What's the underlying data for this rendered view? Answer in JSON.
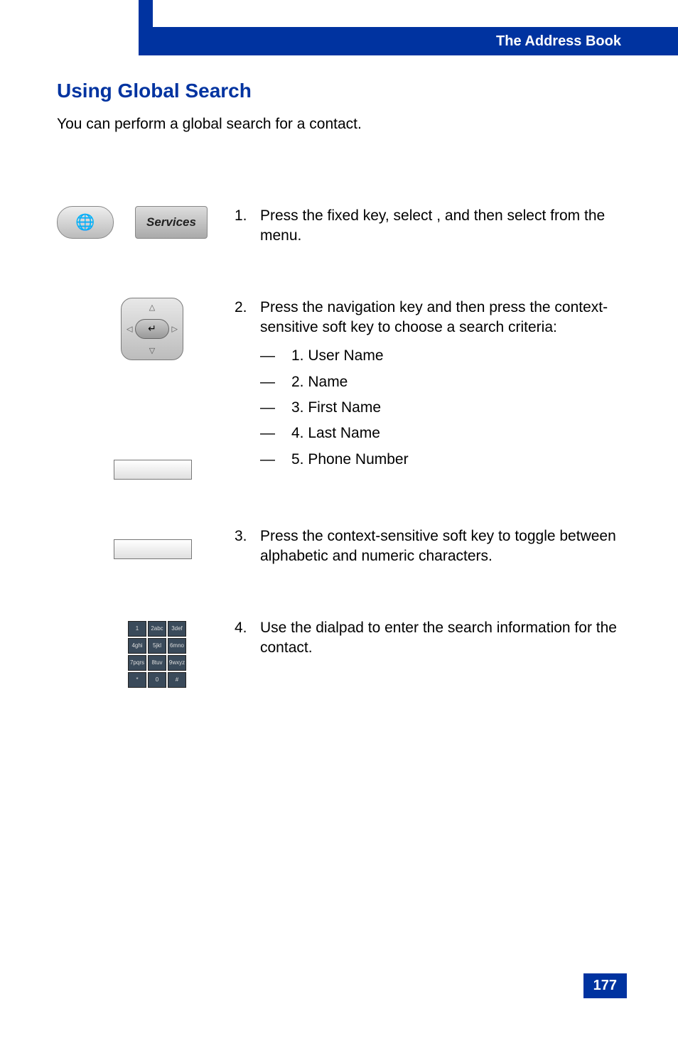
{
  "header": {
    "chapter_title": "The Address Book"
  },
  "section": {
    "title": "Using Global Search",
    "intro": "You can perform a global search for a contact."
  },
  "icons": {
    "services_label": "Services"
  },
  "steps": [
    {
      "num": "1.",
      "body": "Press the              fixed key, select            , and then select            from the menu."
    },
    {
      "num": "2.",
      "body": "Press the              navigation key and then press the            context-sensitive soft key to choose a search criteria:",
      "sub": [
        "1. User Name",
        "2. Name",
        "3. First Name",
        "4. Last Name",
        "5. Phone Number"
      ]
    },
    {
      "num": "3.",
      "body": "Press the            context-sensitive soft key to toggle between alphabetic and numeric characters."
    },
    {
      "num": "4.",
      "body": "Use the dialpad to enter the search information for the contact."
    }
  ],
  "dialpad_keys": [
    "1",
    "2abc",
    "3def",
    "4ghi",
    "5jkl",
    "6mno",
    "7pqrs",
    "8tuv",
    "9wxyz",
    "*",
    "0",
    "#"
  ],
  "page_number": "177"
}
